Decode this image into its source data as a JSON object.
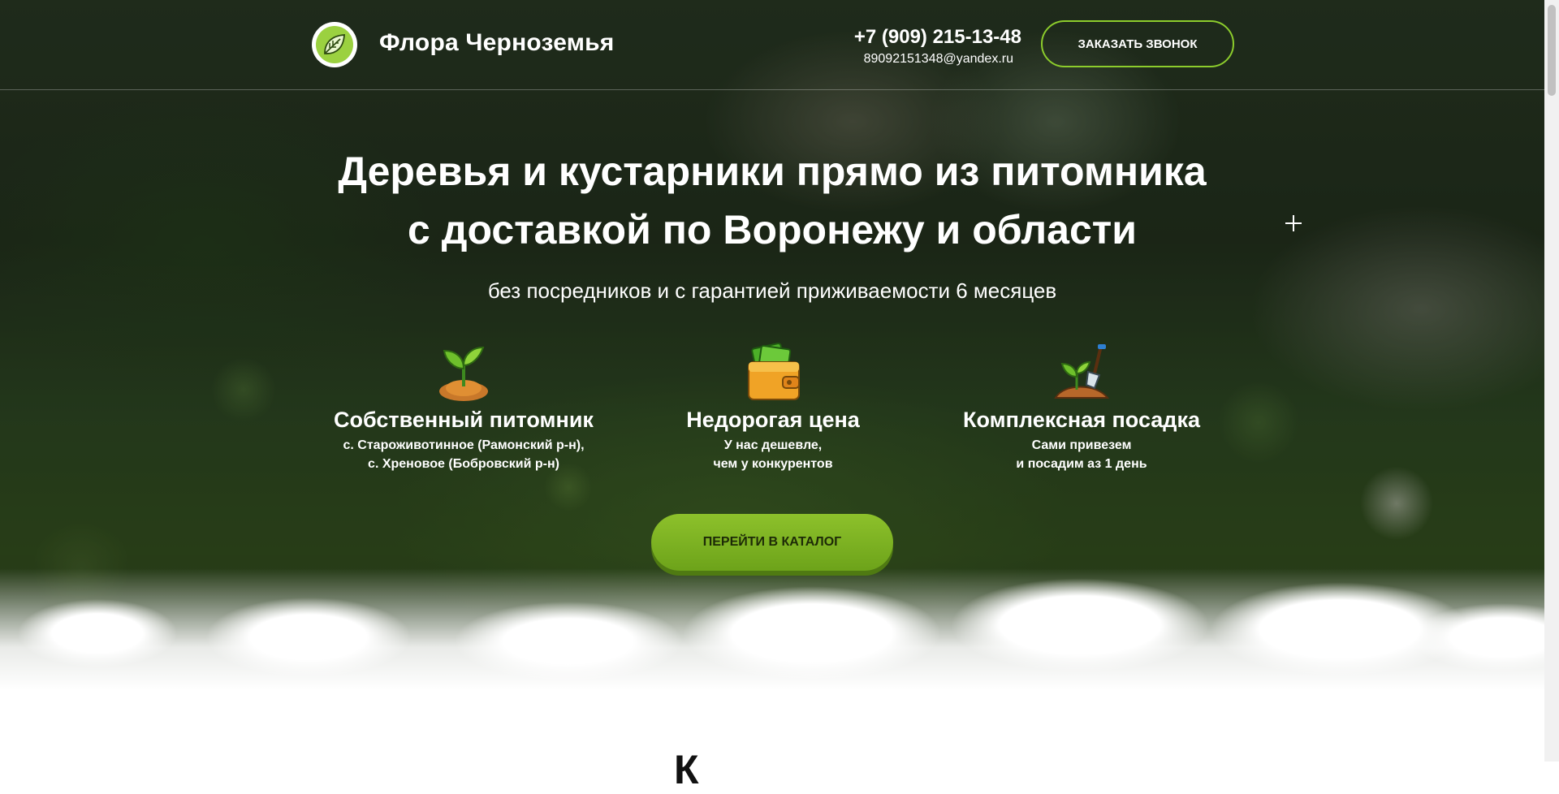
{
  "header": {
    "brand": "Флора Черноземья",
    "phone": "+7 (909) 215-13-48",
    "email": "89092151348@yandex.ru",
    "callback_label": "ЗАКАЗАТЬ ЗВОНОК"
  },
  "hero": {
    "title_line1": "Деревья и кустарники прямо из питомника",
    "title_line2": "с доставкой по Воронежу и области",
    "subtitle": "без посредников и с гарантией приживаемости 6 месяцев",
    "features": [
      {
        "icon": "sprout-icon",
        "title": "Собственный питомник",
        "desc_line1": "с. Староживотинное (Рамонский р-н),",
        "desc_line2": "с. Хреновое (Бобровский р-н)"
      },
      {
        "icon": "wallet-money-icon",
        "title": "Недорогая цена",
        "desc_line1": "У нас дешевле,",
        "desc_line2": "чем у конкурентов"
      },
      {
        "icon": "planting-shovel-icon",
        "title": "Комплексная посадка",
        "desc_line1": "Сами привезем",
        "desc_line2": "и посадим аз 1 день"
      }
    ],
    "catalog_label": "ПЕРЕЙТИ В КАТАЛОГ"
  },
  "next_section": {
    "heading_partial": "К"
  },
  "colors": {
    "accent": "#8ccc2c",
    "button": "#7ab322",
    "text": "#ffffff"
  }
}
